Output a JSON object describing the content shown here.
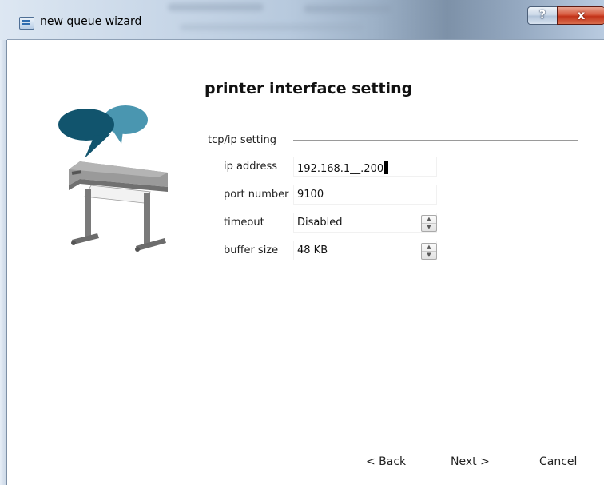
{
  "window": {
    "title": "new queue wizard",
    "help_label": "?",
    "close_label": "x"
  },
  "page": {
    "title": "printer interface setting"
  },
  "group": {
    "label": "tcp/ip setting"
  },
  "fields": {
    "ip_address": {
      "label": "ip address",
      "value": "192.168.1__.200"
    },
    "port_number": {
      "label": "port number",
      "value": "9100"
    },
    "timeout": {
      "label": "timeout",
      "value": "Disabled"
    },
    "buffer_size": {
      "label": "buffer size",
      "value": "48 KB"
    }
  },
  "buttons": {
    "back": "< Back",
    "next": "Next >",
    "cancel": "Cancel"
  },
  "icons": {
    "app": "queue-app-icon",
    "illustration": "printer-with-speech-bubbles"
  },
  "colors": {
    "bubble_dark": "#11546d",
    "bubble_light": "#4a96b0",
    "printer_body": "#8a8a8a",
    "close_button": "#c8381f"
  }
}
